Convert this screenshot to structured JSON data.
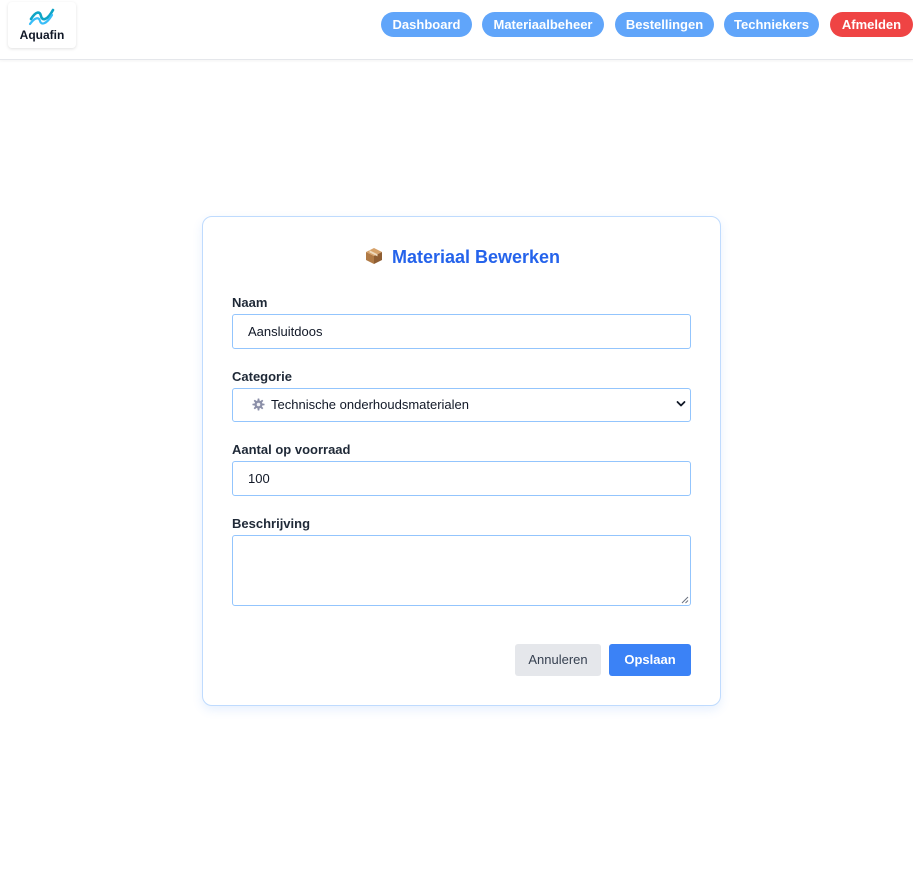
{
  "header": {
    "logo_text": "Aquafin",
    "nav": [
      {
        "label": "Dashboard"
      },
      {
        "label": "Materiaalbeheer"
      },
      {
        "label": "Bestellingen"
      },
      {
        "label": "Techniekers"
      }
    ],
    "logout_label": "Afmelden"
  },
  "form": {
    "title": "Materiaal Bewerken",
    "title_icon": "package-icon",
    "name": {
      "label": "Naam",
      "value": "Aansluitdoos"
    },
    "category": {
      "label": "Categorie",
      "icon": "gear-icon",
      "selected": "Technische onderhoudsmaterialen"
    },
    "stock": {
      "label": "Aantal op voorraad",
      "value": "100"
    },
    "description": {
      "label": "Beschrijving",
      "value": ""
    },
    "cancel_label": "Annuleren",
    "save_label": "Opslaan"
  },
  "colors": {
    "accent": "#3b82f6",
    "nav_button": "#60a5fa",
    "logout": "#ef4444",
    "title": "#2563eb"
  }
}
